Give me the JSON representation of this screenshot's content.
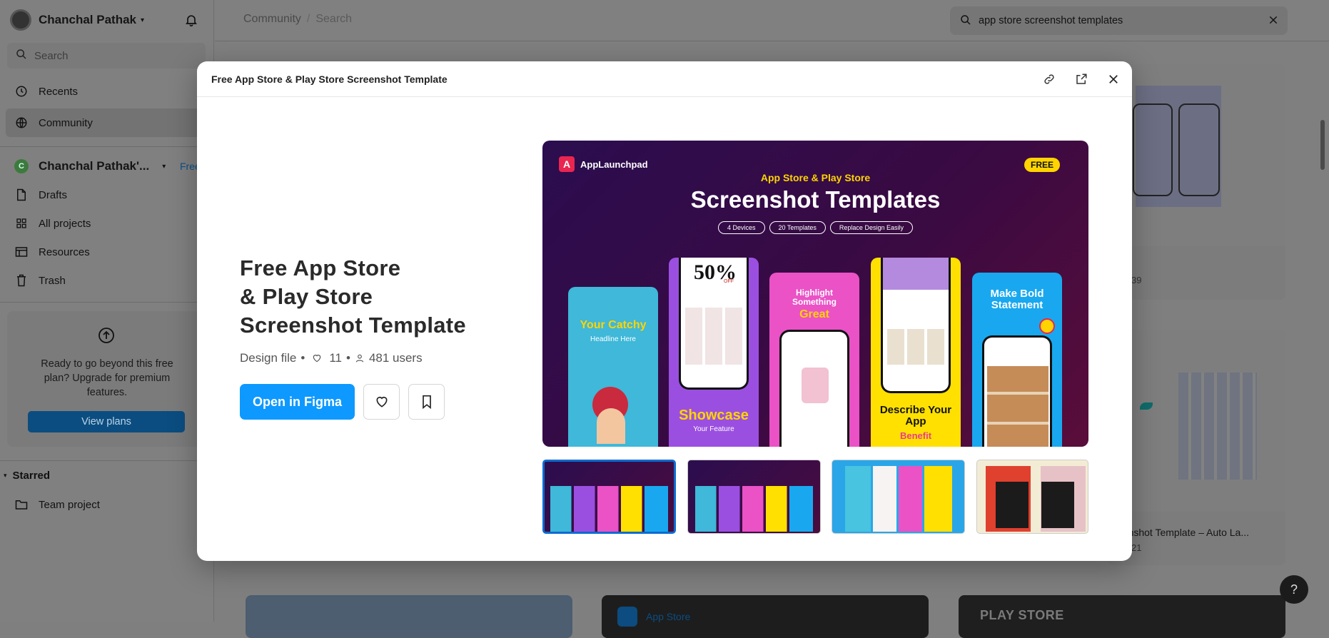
{
  "sidebar": {
    "user_name": "Chanchal Pathak",
    "search_placeholder": "Search",
    "nav": [
      {
        "label": "Recents",
        "icon": "clock-icon"
      },
      {
        "label": "Community",
        "icon": "globe-icon"
      }
    ],
    "team": {
      "name": "Chanchal Pathak'...",
      "badge": "Free",
      "avatar_letter": "C"
    },
    "team_nav": [
      {
        "label": "Drafts",
        "icon": "file-icon"
      },
      {
        "label": "All projects",
        "icon": "grid-icon"
      },
      {
        "label": "Resources",
        "icon": "resources-icon"
      },
      {
        "label": "Trash",
        "icon": "trash-icon"
      }
    ],
    "upgrade": {
      "text": "Ready to go beyond this free plan? Upgrade for premium features.",
      "button": "View plans"
    },
    "starred_label": "Starred",
    "starred_items": [
      "Team project"
    ]
  },
  "topbar": {
    "breadcrumb": [
      "Community",
      "Search"
    ],
    "search_value": "app store screenshot templates"
  },
  "background_cards": {
    "card1_title": "te",
    "card1_count": "39",
    "card2_title": "eenshot Template – Auto La...",
    "card2_count": "21",
    "bottom_labels": [
      "App Store",
      "PLAY STORE"
    ]
  },
  "modal": {
    "header_title": "Free App Store & Play Store Screenshot Template",
    "title_lines": [
      "Free App Store",
      "& Play Store",
      "Screenshot Template"
    ],
    "file_type": "Design file",
    "likes": "11",
    "users": "481 users",
    "open_button": "Open in Figma",
    "hero": {
      "brand": "AppLaunchpad",
      "badge": "FREE",
      "kicker": "App Store & Play Store",
      "headline": "Screenshot Templates",
      "pills": [
        "4 Devices",
        "20 Templates",
        "Replace Design Easily"
      ],
      "phone_texts": [
        "Your Catchy",
        "Headline Here",
        "50%",
        "OFF",
        "Showcase",
        "Your Feature",
        "Highlight Something",
        "Great",
        "Describe Your App",
        "Benefit",
        "Make Bold Statement"
      ]
    }
  },
  "colors": {
    "primary": "#0d99ff",
    "hero_bg": "#2b0d4f",
    "accent_yellow": "#ffd400"
  }
}
